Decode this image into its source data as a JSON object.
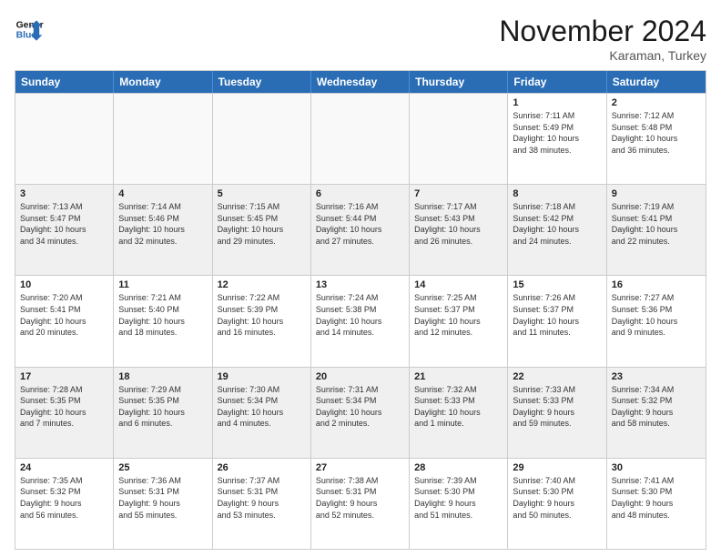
{
  "header": {
    "logo_line1": "General",
    "logo_line2": "Blue",
    "month_title": "November 2024",
    "subtitle": "Karaman, Turkey"
  },
  "weekdays": [
    "Sunday",
    "Monday",
    "Tuesday",
    "Wednesday",
    "Thursday",
    "Friday",
    "Saturday"
  ],
  "rows": [
    [
      {
        "day": "",
        "empty": true
      },
      {
        "day": "",
        "empty": true
      },
      {
        "day": "",
        "empty": true
      },
      {
        "day": "",
        "empty": true
      },
      {
        "day": "",
        "empty": true
      },
      {
        "day": "1",
        "info": "Sunrise: 7:11 AM\nSunset: 5:49 PM\nDaylight: 10 hours\nand 38 minutes."
      },
      {
        "day": "2",
        "info": "Sunrise: 7:12 AM\nSunset: 5:48 PM\nDaylight: 10 hours\nand 36 minutes."
      }
    ],
    [
      {
        "day": "3",
        "info": "Sunrise: 7:13 AM\nSunset: 5:47 PM\nDaylight: 10 hours\nand 34 minutes."
      },
      {
        "day": "4",
        "info": "Sunrise: 7:14 AM\nSunset: 5:46 PM\nDaylight: 10 hours\nand 32 minutes."
      },
      {
        "day": "5",
        "info": "Sunrise: 7:15 AM\nSunset: 5:45 PM\nDaylight: 10 hours\nand 29 minutes."
      },
      {
        "day": "6",
        "info": "Sunrise: 7:16 AM\nSunset: 5:44 PM\nDaylight: 10 hours\nand 27 minutes."
      },
      {
        "day": "7",
        "info": "Sunrise: 7:17 AM\nSunset: 5:43 PM\nDaylight: 10 hours\nand 26 minutes."
      },
      {
        "day": "8",
        "info": "Sunrise: 7:18 AM\nSunset: 5:42 PM\nDaylight: 10 hours\nand 24 minutes."
      },
      {
        "day": "9",
        "info": "Sunrise: 7:19 AM\nSunset: 5:41 PM\nDaylight: 10 hours\nand 22 minutes."
      }
    ],
    [
      {
        "day": "10",
        "info": "Sunrise: 7:20 AM\nSunset: 5:41 PM\nDaylight: 10 hours\nand 20 minutes."
      },
      {
        "day": "11",
        "info": "Sunrise: 7:21 AM\nSunset: 5:40 PM\nDaylight: 10 hours\nand 18 minutes."
      },
      {
        "day": "12",
        "info": "Sunrise: 7:22 AM\nSunset: 5:39 PM\nDaylight: 10 hours\nand 16 minutes."
      },
      {
        "day": "13",
        "info": "Sunrise: 7:24 AM\nSunset: 5:38 PM\nDaylight: 10 hours\nand 14 minutes."
      },
      {
        "day": "14",
        "info": "Sunrise: 7:25 AM\nSunset: 5:37 PM\nDaylight: 10 hours\nand 12 minutes."
      },
      {
        "day": "15",
        "info": "Sunrise: 7:26 AM\nSunset: 5:37 PM\nDaylight: 10 hours\nand 11 minutes."
      },
      {
        "day": "16",
        "info": "Sunrise: 7:27 AM\nSunset: 5:36 PM\nDaylight: 10 hours\nand 9 minutes."
      }
    ],
    [
      {
        "day": "17",
        "info": "Sunrise: 7:28 AM\nSunset: 5:35 PM\nDaylight: 10 hours\nand 7 minutes."
      },
      {
        "day": "18",
        "info": "Sunrise: 7:29 AM\nSunset: 5:35 PM\nDaylight: 10 hours\nand 6 minutes."
      },
      {
        "day": "19",
        "info": "Sunrise: 7:30 AM\nSunset: 5:34 PM\nDaylight: 10 hours\nand 4 minutes."
      },
      {
        "day": "20",
        "info": "Sunrise: 7:31 AM\nSunset: 5:34 PM\nDaylight: 10 hours\nand 2 minutes."
      },
      {
        "day": "21",
        "info": "Sunrise: 7:32 AM\nSunset: 5:33 PM\nDaylight: 10 hours\nand 1 minute."
      },
      {
        "day": "22",
        "info": "Sunrise: 7:33 AM\nSunset: 5:33 PM\nDaylight: 9 hours\nand 59 minutes."
      },
      {
        "day": "23",
        "info": "Sunrise: 7:34 AM\nSunset: 5:32 PM\nDaylight: 9 hours\nand 58 minutes."
      }
    ],
    [
      {
        "day": "24",
        "info": "Sunrise: 7:35 AM\nSunset: 5:32 PM\nDaylight: 9 hours\nand 56 minutes."
      },
      {
        "day": "25",
        "info": "Sunrise: 7:36 AM\nSunset: 5:31 PM\nDaylight: 9 hours\nand 55 minutes."
      },
      {
        "day": "26",
        "info": "Sunrise: 7:37 AM\nSunset: 5:31 PM\nDaylight: 9 hours\nand 53 minutes."
      },
      {
        "day": "27",
        "info": "Sunrise: 7:38 AM\nSunset: 5:31 PM\nDaylight: 9 hours\nand 52 minutes."
      },
      {
        "day": "28",
        "info": "Sunrise: 7:39 AM\nSunset: 5:30 PM\nDaylight: 9 hours\nand 51 minutes."
      },
      {
        "day": "29",
        "info": "Sunrise: 7:40 AM\nSunset: 5:30 PM\nDaylight: 9 hours\nand 50 minutes."
      },
      {
        "day": "30",
        "info": "Sunrise: 7:41 AM\nSunset: 5:30 PM\nDaylight: 9 hours\nand 48 minutes."
      }
    ]
  ]
}
